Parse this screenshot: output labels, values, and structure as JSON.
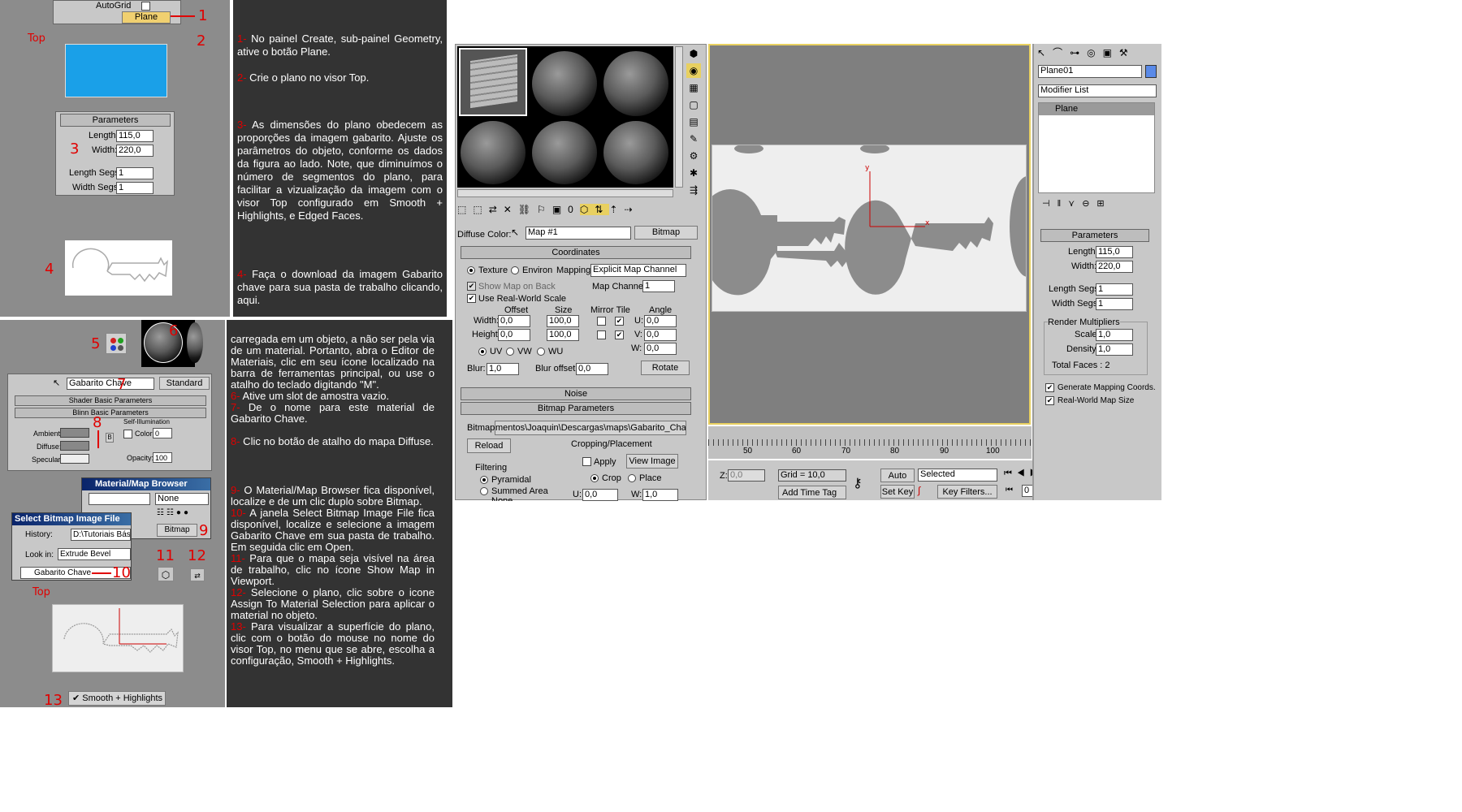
{
  "left_panel": {
    "autogrid_label": "AutoGrid",
    "plane_button": "Plane",
    "top_label": "Top",
    "params_title": "Parameters",
    "length_label": "Length:",
    "length_value": "115,0",
    "width_label": "Width:",
    "width_value": "220,0",
    "length_segs_label": "Length Segs:",
    "length_segs_value": "1",
    "width_segs_label": "Width Segs:",
    "width_segs_value": "1",
    "material_name": "Gabarito Chave",
    "standard_button": "Standard",
    "shader_rollout": "Shader Basic Parameters",
    "blinn_rollout": "Blinn Basic Parameters",
    "self_illum_label": "Self-Illumination",
    "color_label": "Color",
    "color_value": "0",
    "ambient_label": "Ambient:",
    "diffuse_label": "Diffuse:",
    "specular_label": "Specular:",
    "opacity_label": "Opacity:",
    "opacity_value": "100",
    "browser_title": "Material/Map Browser",
    "browser_none": "None",
    "browser_bitmap": "Bitmap",
    "select_title": "Select Bitmap Image File",
    "history_label": "History:",
    "history_value": "D:\\Tutoriais Básic",
    "lookin_label": "Look in:",
    "lookin_value": "Extrude Bevel",
    "file_name": "Gabarito Chave",
    "top_label2": "Top",
    "smooth_menu": "Smooth + Highlights"
  },
  "step_numbers": [
    "1",
    "2",
    "3",
    "4",
    "5",
    "6",
    "7",
    "8",
    "9",
    "10",
    "11",
    "12",
    "13"
  ],
  "instructions_top": [
    {
      "n": "1-",
      "t": " No painel Create, sub-painel Geometry, ative o botão Plane."
    },
    {
      "n": "2-",
      "t": " Crie o plano no visor Top."
    },
    {
      "n": "3-",
      "t": " As dimensões do plano obedecem as proporções da imagem gabarito. Ajuste os parâmetros do objeto, conforme os dados da figura ao lado. Note, que diminuímos o número de segmentos do plano, para facilitar a vizualização da imagem com o visor Top configurado em Smooth + Highlights, e Edged Faces."
    },
    {
      "n": "4-",
      "t": " Faça o download da imagem Gabarito chave para sua pasta de trabalho clicando, aqui."
    }
  ],
  "instructions_bottom": [
    {
      "n": "",
      "t": "carregada em um objeto, a não ser pela via de um material. Portanto, abra o Editor de Materiais, clic em seu ícone localizado na barra de ferramentas principal, ou use o atalho do teclado digitando \"M\"."
    },
    {
      "n": "6-",
      "t": " Ative um slot de amostra vazio."
    },
    {
      "n": "7-",
      "t": " De o nome para este material de Gabarito Chave."
    },
    {
      "n": "8-",
      "t": " Clic no botão de atalho do mapa Diffuse."
    },
    {
      "n": "9-",
      "t": " O Material/Map Browser fica disponível, localize e de um clic duplo sobre Bitmap."
    },
    {
      "n": "10-",
      "t": " A janela Select Bitmap Image File fica disponível, localize e selecione a imagem Gabarito Chave em sua pasta de trabalho. Em seguida clic em Open."
    },
    {
      "n": "11-",
      "t": " Para que o mapa seja visível na área de trabalho, clic no ícone Show Map in Viewport."
    },
    {
      "n": "12-",
      "t": " Selecione o plano, clic sobre o icone Assign To Material Selection para aplicar o material no objeto."
    },
    {
      "n": "13-",
      "t": " Para visualizar a superfície do plano, clic com o botão do mouse no nome do visor Top, no menu que se abre, escolha a configuração, Smooth + Highlights."
    }
  ],
  "material_editor": {
    "diffuse_color_label": "Diffuse Color:",
    "map_name": "Map #1",
    "map_type": "Bitmap",
    "coordinates_rollout": "Coordinates",
    "texture_label": "Texture",
    "environ_label": "Environ",
    "mapping_label": "Mapping:",
    "mapping_value": "Explicit Map Channel",
    "show_map_back": "Show Map on Back",
    "map_channel_label": "Map Channel:",
    "map_channel_value": "1",
    "real_world": "Use Real-World Scale",
    "offset_hdr": "Offset",
    "size_hdr": "Size",
    "mirror_tile_hdr": "Mirror Tile",
    "angle_hdr": "Angle",
    "width_label": "Width:",
    "height_label": "Height:",
    "off_w": "0,0",
    "off_h": "0,0",
    "size_w": "100,0",
    "size_h": "100,0",
    "u_label": "U:",
    "v_label": "V:",
    "w_label": "W:",
    "ang_u": "0,0",
    "ang_v": "0,0",
    "ang_w": "0,0",
    "uv": "UV",
    "vw": "VW",
    "wu": "WU",
    "blur_label": "Blur:",
    "blur_value": "1,0",
    "blur_offset_label": "Blur offset:",
    "blur_offset_value": "0,0",
    "rotate_button": "Rotate",
    "noise_rollout": "Noise",
    "bitmap_params_rollout": "Bitmap Parameters",
    "bitmap_label": "Bitmap:",
    "bitmap_path": "mentos\\Joaquin\\Descargas\\maps\\Gabarito_Chave.jpg",
    "reload_button": "Reload",
    "cropping_label": "Cropping/Placement",
    "apply_label": "Apply",
    "view_image_button": "View Image",
    "crop_label": "Crop",
    "place_label": "Place",
    "u_val": "0,0",
    "w_val": "1,0",
    "filtering_label": "Filtering",
    "pyramidal_label": "Pyramidal",
    "summed_label": "Summed Area",
    "none_label": "None"
  },
  "viewport": {
    "axis_y": "y",
    "axis_x": "x",
    "ruler_ticks": [
      "50",
      "60",
      "70",
      "80",
      "90",
      "100"
    ]
  },
  "status_bar": {
    "z_label": "Z:",
    "z_value": "0,0",
    "grid": "Grid = 10,0",
    "add_time_tag": "Add Time Tag",
    "auto_key": "Auto Key",
    "selected": "Selected",
    "set_key": "Set Key",
    "key_filters": "Key Filters...",
    "frame": "0"
  },
  "command_panel": {
    "object_name": "Plane01",
    "modifier_list": "Modifier List",
    "stack_item": "Plane",
    "params_title": "Parameters",
    "length_label": "Length:",
    "length_value": "115,0",
    "width_label": "Width:",
    "width_value": "220,0",
    "length_segs_label": "Length Segs:",
    "length_segs_value": "1",
    "width_segs_label": "Width Segs:",
    "width_segs_value": "1",
    "render_mult": "Render Multipliers",
    "scale_label": "Scale:",
    "scale_value": "1,0",
    "density_label": "Density:",
    "density_value": "1,0",
    "total_faces": "Total Faces : 2",
    "gen_mapping": "Generate Mapping Coords.",
    "real_world_map": "Real-World Map Size"
  },
  "colors": {
    "accent_red": "#e00000",
    "plane_blue": "#1aa0e8",
    "panel_grey": "#8c8c8c",
    "dark_text_panel": "#333333",
    "max_grey": "#c8c8c8",
    "viewport_grey": "#7f7f7f"
  }
}
